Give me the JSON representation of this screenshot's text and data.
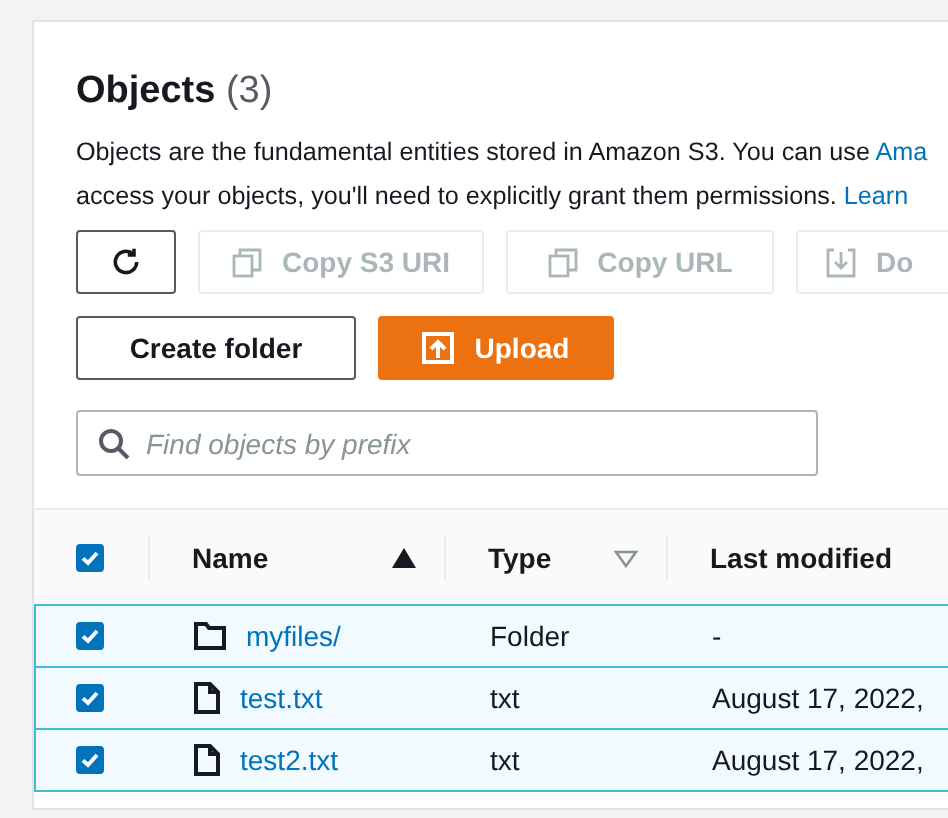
{
  "panel": {
    "title": "Objects",
    "count": "(3)",
    "description": {
      "text_1": "Objects are the fundamental entities stored in Amazon S3. You can use",
      "link_1": "Ama",
      "text_2": "access your objects, you'll need to explicitly grant them permissions.",
      "link_2": "Learn"
    }
  },
  "actions": [
    {
      "kind": "refresh",
      "disabled": false
    },
    {
      "kind": "copy",
      "label": "Copy S3 URI",
      "disabled": true
    },
    {
      "kind": "copy",
      "label": "Copy URL",
      "disabled": true
    },
    {
      "kind": "download",
      "label": "Do",
      "disabled": true
    }
  ],
  "buttons": [
    {
      "kind": "secondary",
      "label": "Create folder"
    },
    {
      "kind": "primary",
      "label": "Upload"
    }
  ],
  "search": {
    "placeholder": "Find objects by prefix"
  },
  "table": {
    "select_all": {
      "checked": true
    },
    "columns": [
      {
        "label": "Name",
        "sorted": true
      },
      {
        "label": "Type",
        "sorted": false
      },
      {
        "label": "Last modified"
      }
    ],
    "rows": [
      {
        "kind": "folder",
        "name": "myfiles/",
        "type": "Folder",
        "last_modified": "-",
        "selected": true,
        "checked": true
      },
      {
        "kind": "file",
        "name": "test.txt",
        "type": "txt",
        "last_modified": "August 17, 2022,",
        "selected": true,
        "checked": true
      },
      {
        "kind": "file",
        "name": "test2.txt",
        "type": "txt",
        "last_modified": "August 17, 2022,",
        "selected": true,
        "checked": true
      }
    ]
  }
}
